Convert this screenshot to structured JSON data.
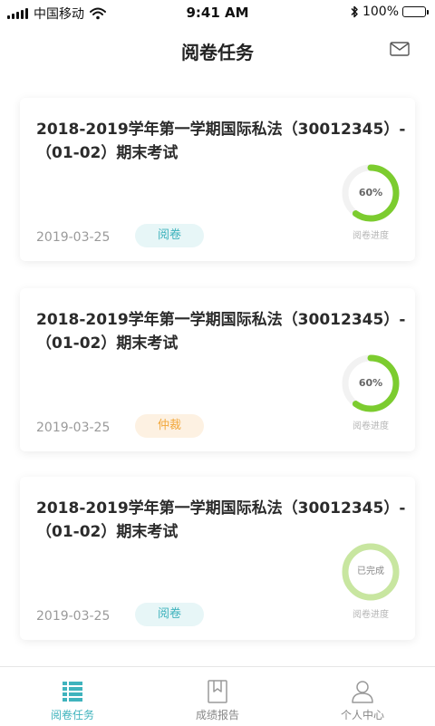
{
  "status_bar": {
    "carrier": "中国移动",
    "time": "9:41 AM",
    "battery": "100%"
  },
  "header": {
    "title": "阅卷任务",
    "mail_icon": "mail-icon"
  },
  "tasks": [
    {
      "title": "2018-2019学年第一学期国际私法（30012345）-（01-02）期末考试",
      "date": "2019-03-25",
      "tag": "阅卷",
      "tag_color": "#3fb3bd",
      "progress": 0.6,
      "progress_text": "60%",
      "progress_label": "阅卷进度"
    },
    {
      "title": "2018-2019学年第一学期国际私法（30012345）-（01-02）期末考试",
      "date": "2019-03-25",
      "tag": "仲裁",
      "tag_color": "#f2a73a",
      "progress": 0.6,
      "progress_text": "60%",
      "progress_label": "阅卷进度"
    },
    {
      "title": "2018-2019学年第一学期国际私法（30012345）-（01-02）期末考试",
      "date": "2019-03-25",
      "tag": "阅卷",
      "tag_color": "#3fb3bd",
      "progress": 1.0,
      "progress_text": "已完成",
      "progress_label": "阅卷进度"
    }
  ],
  "colors": {
    "accent": "#3fb3bd",
    "progress_green": "#7ccc2f",
    "progress_done": "#c8e6a0",
    "track": "#f2f2f2"
  },
  "tab_bar": {
    "items": [
      {
        "label": "阅卷任务",
        "icon": "task-list-icon",
        "active": true
      },
      {
        "label": "成绩报告",
        "icon": "bookmark-icon",
        "active": false
      },
      {
        "label": "个人中心",
        "icon": "user-icon",
        "active": false
      }
    ]
  }
}
